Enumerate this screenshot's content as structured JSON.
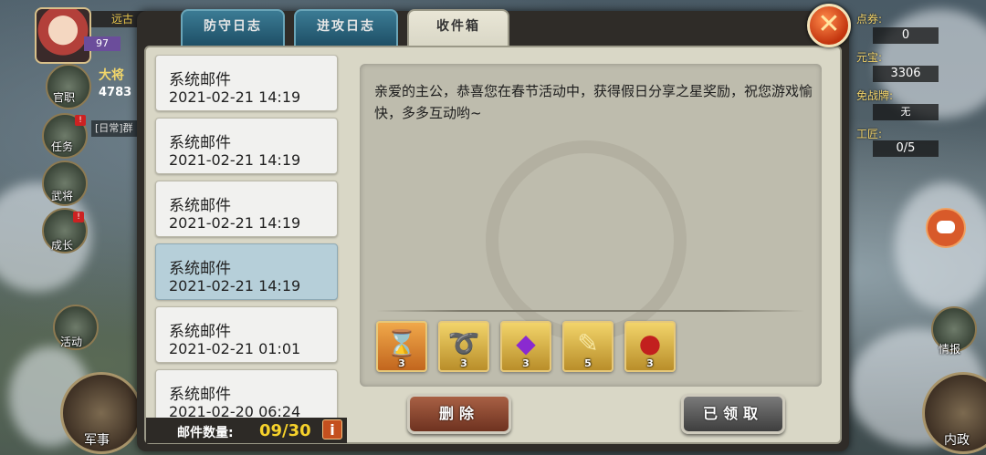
{
  "hud_left": {
    "region": "远古",
    "level": "97",
    "rank_label": "大将",
    "rank_value": "4783",
    "daily_label": "[日常]群",
    "buttons": [
      "官职",
      "任务",
      "武将",
      "成长",
      "活动"
    ],
    "main_button": "军事"
  },
  "hud_right": {
    "stats": [
      {
        "label": "点券:",
        "value": "0"
      },
      {
        "label": "元宝:",
        "value": "3306"
      },
      {
        "label": "免战牌:",
        "value": "无"
      },
      {
        "label": "工匠:",
        "value": "0/5"
      }
    ],
    "intel_label": "情报",
    "main_button": "内政"
  },
  "tabs": [
    {
      "label": "防守日志",
      "active": false
    },
    {
      "label": "进攻日志",
      "active": false
    },
    {
      "label": "收件箱",
      "active": true
    }
  ],
  "close_icon": "close-x-icon",
  "mails": [
    {
      "title": "系统邮件",
      "date": "2021-02-21 14:19",
      "selected": false
    },
    {
      "title": "系统邮件",
      "date": "2021-02-21 14:19",
      "selected": false
    },
    {
      "title": "系统邮件",
      "date": "2021-02-21 14:19",
      "selected": false
    },
    {
      "title": "系统邮件",
      "date": "2021-02-21 14:19",
      "selected": true
    },
    {
      "title": "系统邮件",
      "date": "2021-02-21 01:01",
      "selected": false
    },
    {
      "title": "系统邮件",
      "date": "2021-02-20 06:24",
      "selected": false
    }
  ],
  "mail_count": {
    "label": "邮件数量:",
    "value": "09/30",
    "info_glyph": "i"
  },
  "message": "亲爱的主公，恭喜您在春节活动中，获得假日分享之星奖励，祝您游戏愉快，多多互动哟~",
  "attachments": [
    {
      "icon": "hourglass-icon",
      "glyph": "⌛",
      "qty": "3",
      "color": "#e08a2e"
    },
    {
      "icon": "rope-icon",
      "glyph": "➰",
      "qty": "3",
      "color": "#d4b24a"
    },
    {
      "icon": "purple-gem-icon",
      "glyph": "◆",
      "qty": "3",
      "color": "#d4b24a"
    },
    {
      "icon": "scroll-icon",
      "glyph": "✎",
      "qty": "5",
      "color": "#d4b24a"
    },
    {
      "icon": "red-gem-icon",
      "glyph": "●",
      "qty": "3",
      "color": "#d4b24a"
    }
  ],
  "buttons": {
    "delete": "删除",
    "claimed": "已领取"
  }
}
